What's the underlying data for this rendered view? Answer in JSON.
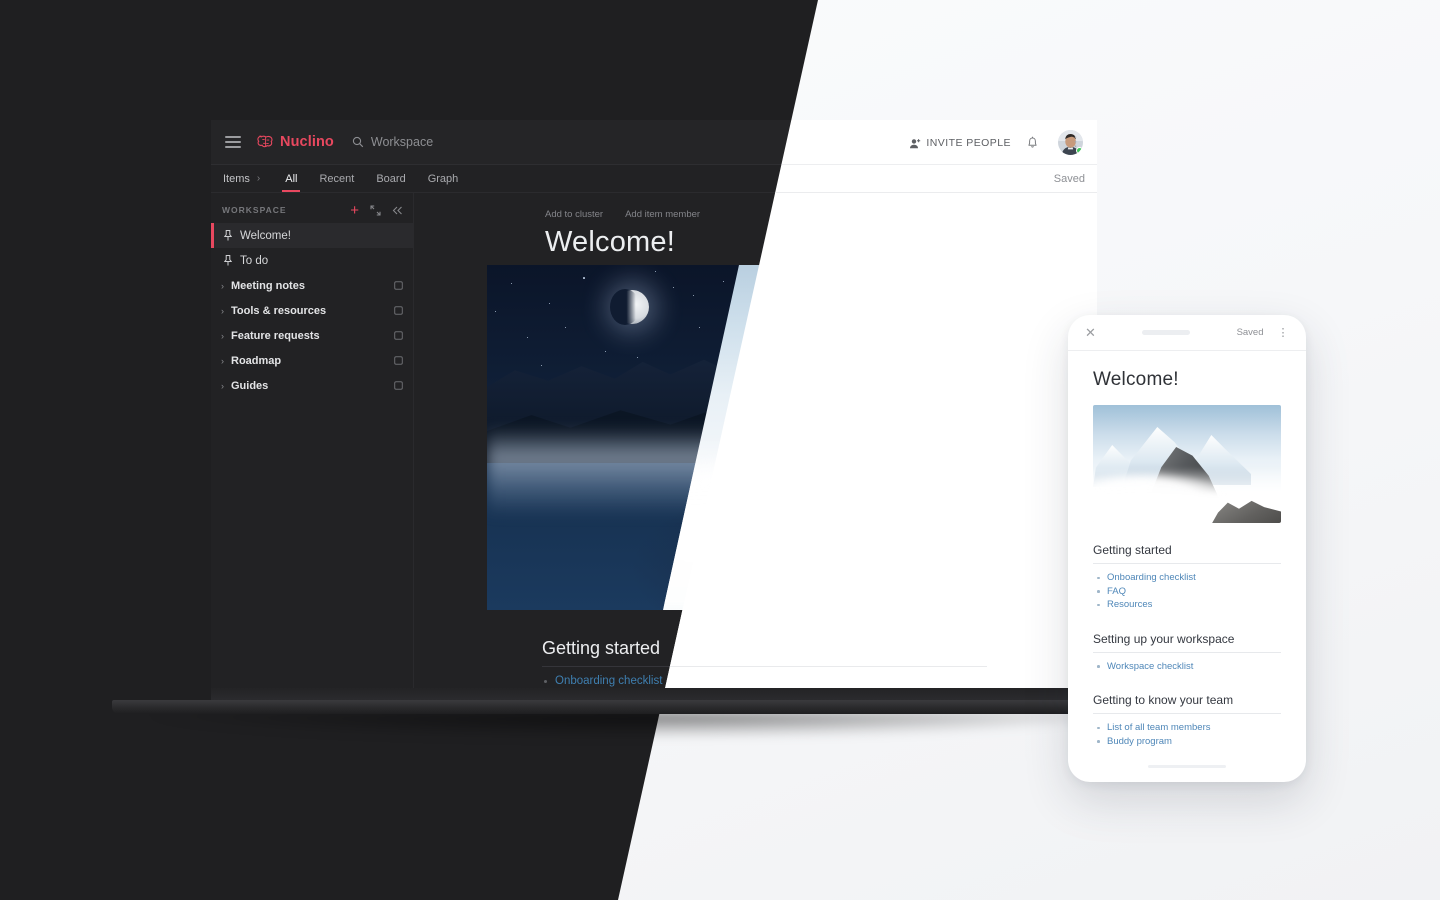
{
  "app": {
    "brand": "Nuclino",
    "brand_color": "#e8485f",
    "menu_icon": "hamburger-icon",
    "search": {
      "icon": "search-icon",
      "placeholder": "Workspace",
      "value": "Workspace"
    },
    "header_actions": {
      "invite_label": "INVITE PEOPLE",
      "invite_icon": "add-person-icon",
      "notifications_icon": "bell-icon",
      "avatar": "user-avatar",
      "status": "online"
    },
    "save_status": "Saved"
  },
  "tabs": {
    "breadcrumb": "Items",
    "breadcrumb_chevron": "›",
    "items": [
      {
        "label": "All",
        "active": true
      },
      {
        "label": "Recent",
        "active": false
      },
      {
        "label": "Board",
        "active": false
      },
      {
        "label": "Graph",
        "active": false
      }
    ]
  },
  "sidebar": {
    "section_title": "WORKSPACE",
    "actions": [
      {
        "name": "add-icon",
        "glyph": "+"
      },
      {
        "name": "expand-icon",
        "glyph": "⤢"
      },
      {
        "name": "collapse-sidebar-icon",
        "glyph": "«"
      }
    ],
    "pinned": [
      {
        "label": "Welcome!",
        "icon": "pin-icon",
        "active": true
      },
      {
        "label": "To do",
        "icon": "pin-icon",
        "active": false
      }
    ],
    "groups": [
      {
        "label": "Meeting notes",
        "caret": "›",
        "trailing_icon": "cluster-icon"
      },
      {
        "label": "Tools & resources",
        "caret": "›",
        "trailing_icon": "cluster-icon"
      },
      {
        "label": "Feature requests",
        "caret": "›",
        "trailing_icon": "cluster-icon"
      },
      {
        "label": "Roadmap",
        "caret": "›",
        "trailing_icon": "cluster-icon"
      },
      {
        "label": "Guides",
        "caret": "›",
        "trailing_icon": "cluster-icon"
      }
    ]
  },
  "document": {
    "toolbar": [
      {
        "label": "Add to cluster"
      },
      {
        "label": "Add item member"
      }
    ],
    "kebab": "⋮",
    "title": "Welcome!",
    "hero_image_alt": "mountain-peaks-above-clouds",
    "heading": "Getting started",
    "first_link": "Onboarding checklist",
    "link_color": "#3f7fb0"
  },
  "phone": {
    "close_icon": "close-icon",
    "save_status": "Saved",
    "kebab": "⋮",
    "title": "Welcome!",
    "hero_image_alt": "mountain-peak-above-clouds",
    "sections": [
      {
        "heading": "Getting started",
        "links": [
          "Onboarding checklist",
          "FAQ",
          "Resources"
        ]
      },
      {
        "heading": "Setting up your workspace",
        "links": [
          "Workspace checklist"
        ]
      },
      {
        "heading": "Getting to know your team",
        "links": [
          "List of all team members",
          "Buddy program"
        ]
      }
    ],
    "home_indicator": "home-indicator"
  },
  "theme": {
    "dark_bg": "#222224",
    "light_bg": "#f7f8fa",
    "accent": "#e8485f",
    "link": "#4f87b8",
    "online_dot": "#3ec65a"
  }
}
